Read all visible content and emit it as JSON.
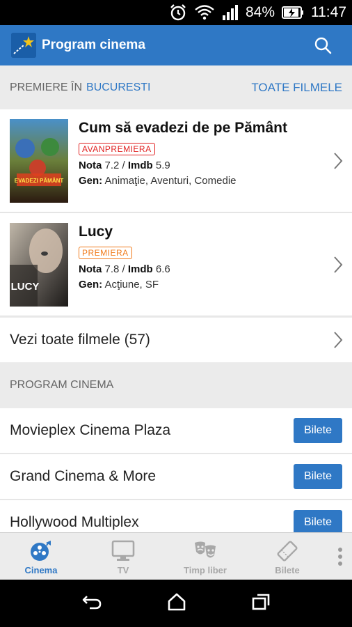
{
  "status_bar": {
    "battery": "84%",
    "time": "11:47",
    "icons": [
      "alarm-icon",
      "wifi-icon",
      "signal-icon",
      "battery-charging-icon"
    ]
  },
  "app_bar": {
    "title": "Program cinema",
    "icons": [
      "app-logo-icon",
      "search-icon"
    ]
  },
  "premieres": {
    "label": "PREMIERE ÎN",
    "city": "BUCURESTI",
    "all_link": "TOATE FILMELE"
  },
  "movies": [
    {
      "title": "Cum să evadezi de pe Pământ",
      "badge": "AVANPREMIERA",
      "nota_label": "Nota",
      "nota": "7.2",
      "imdb_label": "Imdb",
      "imdb": "5.9",
      "gen_label": "Gen:",
      "gen": "Animaţie, Aventuri, Comedie",
      "poster_text": "EVADEZI PĂMÂNT"
    },
    {
      "title": "Lucy",
      "badge": "PREMIERA",
      "nota_label": "Nota",
      "nota": "7.8",
      "imdb_label": "Imdb",
      "imdb": "6.6",
      "gen_label": "Gen:",
      "gen": "Acţiune, SF",
      "poster_text": "LUCY"
    }
  ],
  "all_films": "Vezi toate filmele (57)",
  "program": {
    "header": "PROGRAM CINEMA",
    "cinemas": [
      {
        "name": "Movieplex Cinema Plaza",
        "button": "Bilete"
      },
      {
        "name": "Grand Cinema & More",
        "button": "Bilete"
      },
      {
        "name": "Hollywood Multiplex",
        "button": "Bilete"
      }
    ]
  },
  "bottom_nav": {
    "items": [
      {
        "label": "Cinema",
        "icon": "film-reel-icon",
        "active": true
      },
      {
        "label": "TV",
        "icon": "tv-icon",
        "active": false
      },
      {
        "label": "Timp liber",
        "icon": "theater-masks-icon",
        "active": false
      },
      {
        "label": "Bilete",
        "icon": "ticket-icon",
        "active": false
      }
    ]
  },
  "colors": {
    "accent": "#2f78c5",
    "badge_red": "#e02020",
    "badge_orange": "#f07a1a"
  }
}
